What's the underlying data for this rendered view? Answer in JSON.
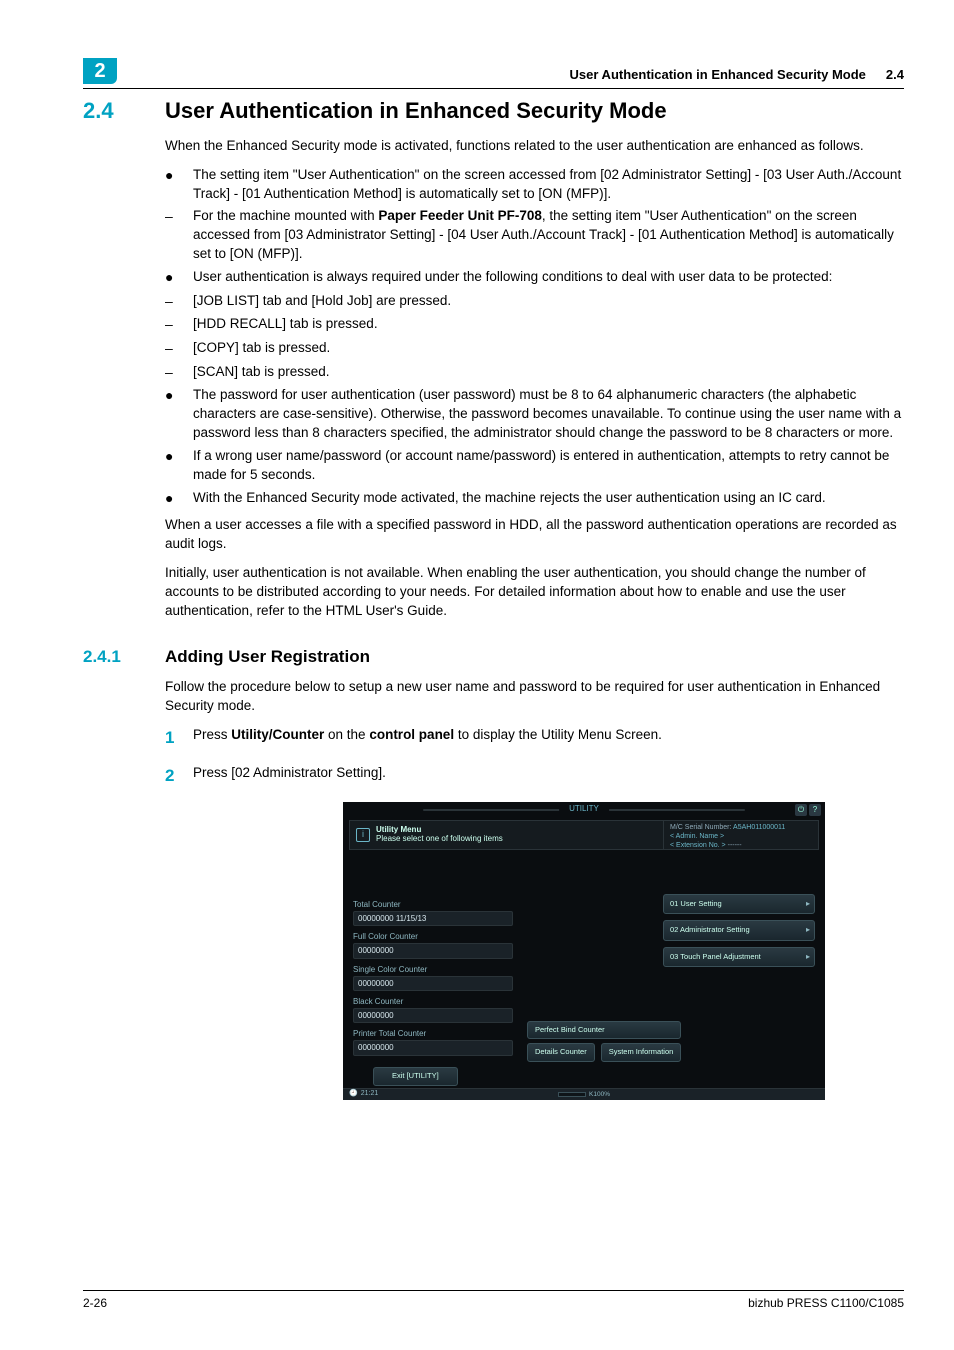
{
  "header": {
    "chapter": "2",
    "title": "User Authentication in Enhanced Security Mode",
    "secref": "2.4"
  },
  "sec24": {
    "num": "2.4",
    "title": "User Authentication in Enhanced Security Mode",
    "intro": "When the Enhanced Security mode is activated, functions related to the user authentication are enhanced as follows.",
    "b1": "The setting item \"User Authentication\" on the screen accessed from [02 Administrator Setting] - [03 User Auth./Account Track] - [01 Authentication Method] is automatically set to [ON (MFP)].",
    "b1a_pre": "For the machine mounted with ",
    "b1a_bold": "Paper Feeder Unit PF-708",
    "b1a_post": ", the setting item \"User Authentication\" on the screen accessed from [03 Administrator Setting] - [04 User Auth./Account Track] - [01 Authentication Method] is automatically set to [ON (MFP)].",
    "b2": "User authentication is always required under the following conditions to deal with user data to be protected:",
    "b2a": "[JOB LIST] tab and [Hold Job] are pressed.",
    "b2b": "[HDD RECALL] tab is pressed.",
    "b2c": "[COPY] tab is pressed.",
    "b2d": "[SCAN] tab is pressed.",
    "b3": "The password for user authentication (user password) must be 8 to 64 alphanumeric characters (the alphabetic characters are case-sensitive). Otherwise, the password becomes unavailable. To continue using the user name with a password less than 8 characters specified, the administrator should change the password to be 8 characters or more.",
    "b4": "If a wrong user name/password (or account name/password) is entered in authentication, attempts to retry cannot be made for 5 seconds.",
    "b5": "With the Enhanced Security mode activated, the machine rejects the user authentication using an IC card.",
    "para1": "When a user accesses a file with a specified password in HDD, all the password authentication operations are recorded as audit logs.",
    "para2": "Initially, user authentication is not available. When enabling the user authentication, you should change the number of accounts to be distributed according to your needs. For detailed information about how to enable and use the user authentication, refer to the HTML User's Guide."
  },
  "sec241": {
    "num": "2.4.1",
    "title": "Adding User Registration",
    "intro": "Follow the procedure below to setup a new user name and password to be required for user authentication in Enhanced Security mode.",
    "step1_pre": "Press ",
    "step1_b1": "Utility/Counter",
    "step1_mid": " on the ",
    "step1_b2": "control panel",
    "step1_post": " to display the Utility Menu Screen.",
    "step2": "Press [02 Administrator Setting]."
  },
  "util": {
    "tab": "UTILITY",
    "menu_label": "Utility Menu",
    "prompt": "Please select one of following items",
    "serial_label": "M/C Serial Number:",
    "serial_val": "A5AH011000011",
    "admin_label": "< Admin. Name >",
    "ext_label": "< Extension No. >",
    "ext_val": "------",
    "counters": {
      "total_lbl": "Total Counter",
      "total_val": "00000000    11/15/13",
      "full_lbl": "Full Color Counter",
      "full_val": "00000000",
      "single_lbl": "Single Color Counter",
      "single_val": "00000000",
      "black_lbl": "Black Counter",
      "black_val": "00000000",
      "printer_lbl": "Printer Total Counter",
      "printer_val": "00000000"
    },
    "menu1": "01 User Setting",
    "menu2": "02 Administrator Setting",
    "menu3": "03 Touch Panel Adjustment",
    "perfect": "Perfect Bind Counter",
    "details": "Details Counter",
    "sysinfo": "System Information",
    "exit": "Exit [UTILITY]",
    "clock": "21:21",
    "mem": "K100%"
  },
  "footer": {
    "page": "2-26",
    "product": "bizhub PRESS C1100/C1085"
  }
}
